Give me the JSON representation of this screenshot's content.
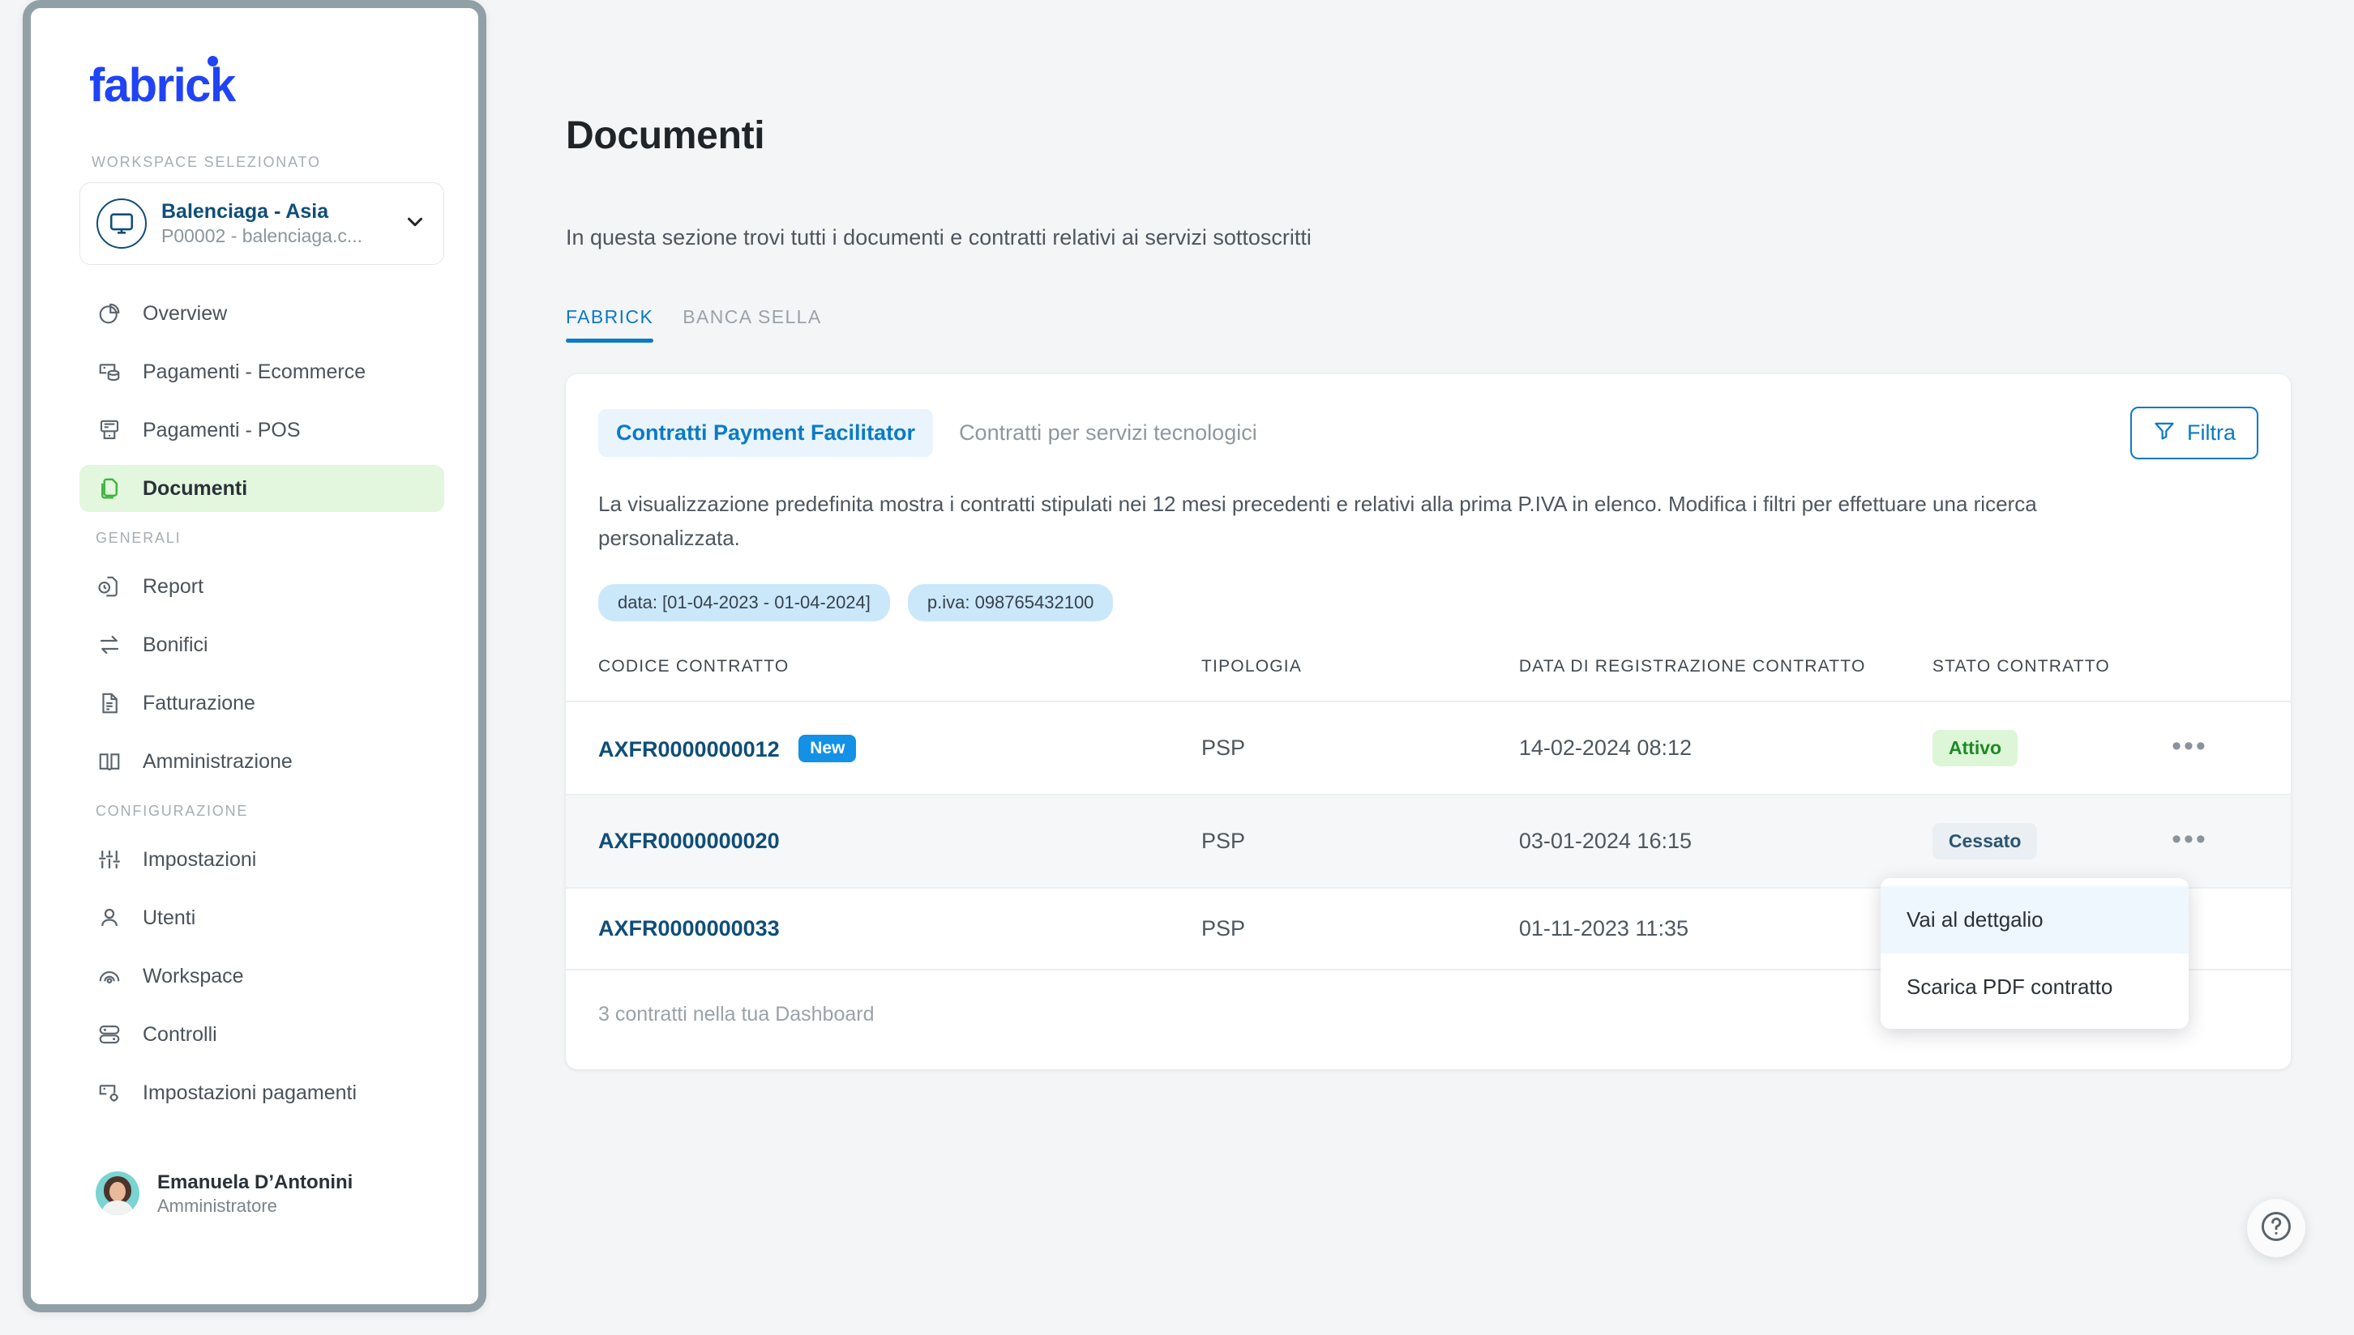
{
  "brand": {
    "logo_text": "fabrick"
  },
  "sidebar": {
    "workspace_label": "WORKSPACE SELEZIONATO",
    "workspace": {
      "name": "Balenciaga - Asia",
      "subtitle": "P00002 - balenciaga.c..."
    },
    "items": [
      {
        "label": "Overview",
        "icon": "pie-chart-icon",
        "active": false
      },
      {
        "label": "Pagamenti - Ecommerce",
        "icon": "ecommerce-payment-icon",
        "active": false
      },
      {
        "label": "Pagamenti - POS",
        "icon": "pos-terminal-icon",
        "active": false
      },
      {
        "label": "Documenti",
        "icon": "documents-icon",
        "active": true
      }
    ],
    "group_generali": "GENERALI",
    "items_generali": [
      {
        "label": "Report",
        "icon": "report-clock-icon",
        "active": false
      },
      {
        "label": "Bonifici",
        "icon": "transfer-arrows-icon",
        "active": false
      },
      {
        "label": "Fatturazione",
        "icon": "invoice-icon",
        "active": false
      },
      {
        "label": "Amministrazione",
        "icon": "book-icon",
        "active": false
      }
    ],
    "group_configurazione": "CONFIGURAZIONE",
    "items_configurazione": [
      {
        "label": "Impostazioni",
        "icon": "sliders-icon",
        "active": false
      },
      {
        "label": "Utenti",
        "icon": "user-icon",
        "active": false
      },
      {
        "label": "Workspace",
        "icon": "workspace-radar-icon",
        "active": false
      },
      {
        "label": "Controlli",
        "icon": "toggles-icon",
        "active": false
      },
      {
        "label": "Impostazioni pagamenti",
        "icon": "payment-settings-icon",
        "active": false
      }
    ],
    "user": {
      "name": "Emanuela D’Antonini",
      "role": "Amministratore"
    }
  },
  "main": {
    "title": "Documenti",
    "subtitle": "In questa sezione trovi tutti i documenti e contratti relativi ai servizi sottoscritti",
    "tabs": [
      {
        "label": "FABRICK",
        "active": true
      },
      {
        "label": "BANCA SELLA",
        "active": false
      }
    ],
    "segments": [
      {
        "label": "Contratti Payment Facilitator",
        "active": true
      },
      {
        "label": "Contratti per servizi tecnologici",
        "active": false
      }
    ],
    "filter_button": "Filtra",
    "description": "La visualizzazione predefinita mostra i contratti stipulati nei 12 mesi precedenti e relativi alla prima P.IVA in elenco.  Modifica i filtri per effettuare una ricerca personalizzata.",
    "chips": [
      {
        "label": "data: [01-04-2023 - 01-04-2024]"
      },
      {
        "label": "p.iva: 098765432100"
      }
    ],
    "table": {
      "columns": [
        "CODICE CONTRATTO",
        "TIPOLOGIA",
        "DATA DI REGISTRAZIONE CONTRATTO",
        "STATO CONTRATTO"
      ],
      "rows": [
        {
          "code": "AXFR0000000012",
          "badge": "New",
          "tipologia": "PSP",
          "data": "14-02-2024 08:12",
          "stato": "Attivo",
          "stato_kind": "attivo",
          "actions": "•••"
        },
        {
          "code": "AXFR0000000020",
          "badge": "",
          "tipologia": "PSP",
          "data": "03-01-2024 16:15",
          "stato": "Cessato",
          "stato_kind": "cessato",
          "actions": "•••"
        },
        {
          "code": "AXFR0000000033",
          "badge": "",
          "tipologia": "PSP",
          "data": "01-11-2023 11:35",
          "stato": "",
          "stato_kind": "",
          "actions": ""
        }
      ],
      "footer": "3 contratti nella tua Dashboard"
    },
    "row_menu": {
      "items": [
        {
          "label": "Vai al dettgalio",
          "highlighted": true
        },
        {
          "label": "Scarica PDF contratto",
          "highlighted": false
        }
      ]
    },
    "help_icon": "help-question-icon"
  },
  "colors": {
    "brand_blue": "#1f43f5",
    "accent_blue": "#0b7ac7",
    "active_nav_bg": "#e2f7de",
    "status_active": "#1e8a24",
    "status_ceased": "#2c5570",
    "badge_new": "#1291e6",
    "backdrop_green": "#4a7054"
  }
}
